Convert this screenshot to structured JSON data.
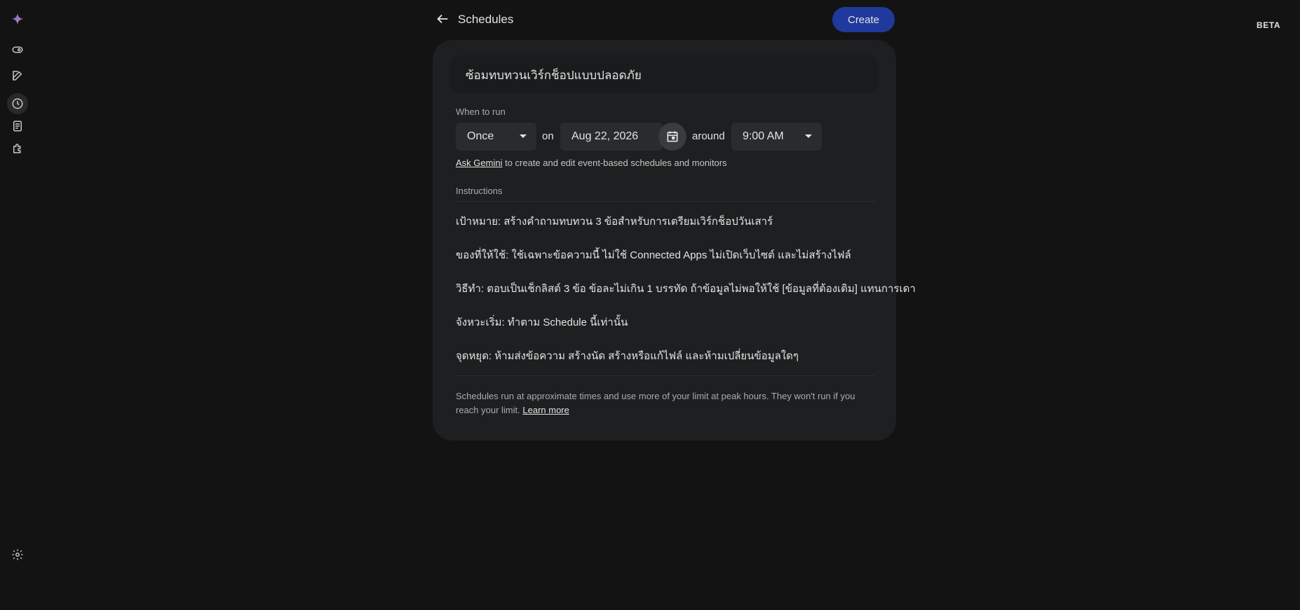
{
  "header": {
    "title": "Schedules",
    "create_label": "Create",
    "beta_label": "BETA"
  },
  "sidebar": {
    "icons": [
      "gemini-logo-icon",
      "toggle-icon",
      "edit-icon",
      "clock-icon",
      "notebook-icon",
      "extensions-icon",
      "settings-icon"
    ]
  },
  "schedule": {
    "name": "ซ้อมทบทวนเวิร์กช็อปแบบปลอดภัย",
    "when_label": "When to run",
    "frequency": "Once",
    "on_word": "on",
    "date": "Aug 22, 2026",
    "around_word": "around",
    "time": "9:00 AM",
    "helper_link": "Ask Gemini",
    "helper_rest": " to create and edit event-based schedules and monitors",
    "instructions_label": "Instructions",
    "instructions": [
      "เป้าหมาย: สร้างคำถามทบทวน 3 ข้อสำหรับการเตรียมเวิร์กช็อปวันเสาร์",
      "ของที่ให้ใช้: ใช้เฉพาะข้อความนี้ ไม่ใช้ Connected Apps ไม่เปิดเว็บไซต์ และไม่สร้างไฟล์",
      "วิธีทำ: ตอบเป็นเช็กลิสต์ 3 ข้อ ข้อละไม่เกิน 1 บรรทัด ถ้าข้อมูลไม่พอให้ใช้ [ข้อมูลที่ต้องเติม] แทนการเดา",
      "จังหวะเริ่ม: ทำตาม Schedule นี้เท่านั้น",
      "จุดหยุด: ห้ามส่งข้อความ สร้างนัด สร้างหรือแก้ไฟล์ และห้ามเปลี่ยนข้อมูลใดๆ"
    ],
    "footer_text": "Schedules run at approximate times and use more of your limit at peak hours. They won't run if you reach your limit. ",
    "footer_link": "Learn more"
  }
}
